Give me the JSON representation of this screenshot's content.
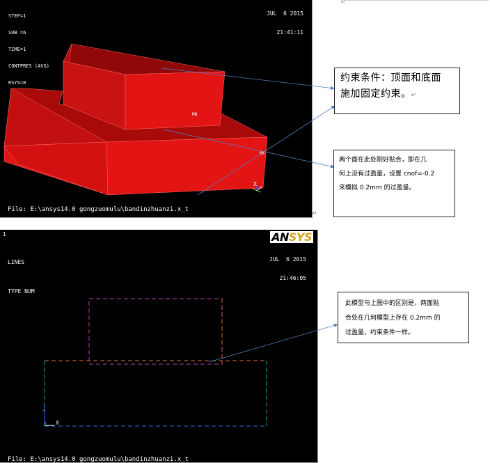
{
  "top_panel": {
    "header_lines": [
      "STEP=1",
      "SUB =6",
      "TIME=1",
      "CONTPRES (AVG)",
      "RSYS=0"
    ],
    "date": "JUL  6 2015",
    "time": "21:41:11",
    "mn_label": "MN",
    "mx_label": "MX",
    "axis_x": "X",
    "file_path": "File: E:\\ansys14.0 gongzuomulu\\bandinzhuanzi.x_t",
    "solid_color": "#e31414"
  },
  "bottom_panel": {
    "window_number": "1",
    "header_lines": [
      "LINES",
      "TYPE NUM"
    ],
    "logo_an": "AN",
    "logo_sys": "SYS",
    "date": "JUL  6 2015",
    "time": "21:46:05",
    "axis_z": "Z",
    "axis_x": "X",
    "file_path": "File: E:\\ansys14.0 gongzuomulu\\bandinzhuanzi.x_t"
  },
  "callouts": {
    "constraint_line1": "约束条件：顶面和底面",
    "constraint_line2": "施加固定约束。",
    "contact_line1": "两个面在此处刚好贴合，即在几",
    "contact_line2": "何上没有过盈量，设置 cnof=-0.2",
    "contact_line3": "来模拟 0.2mm 的过盈量。",
    "model_line1": "此模型与上图中的区别是，两面贴",
    "model_line2": "合处在几何模型上存在  0.2mm  的",
    "model_line3": "过盈量，约束条件一样。",
    "return_mark": "↵"
  },
  "colors": {
    "arrow": "#4f7fbf",
    "panel_bg": "#000000",
    "logo_sys": "#d4a51c"
  }
}
